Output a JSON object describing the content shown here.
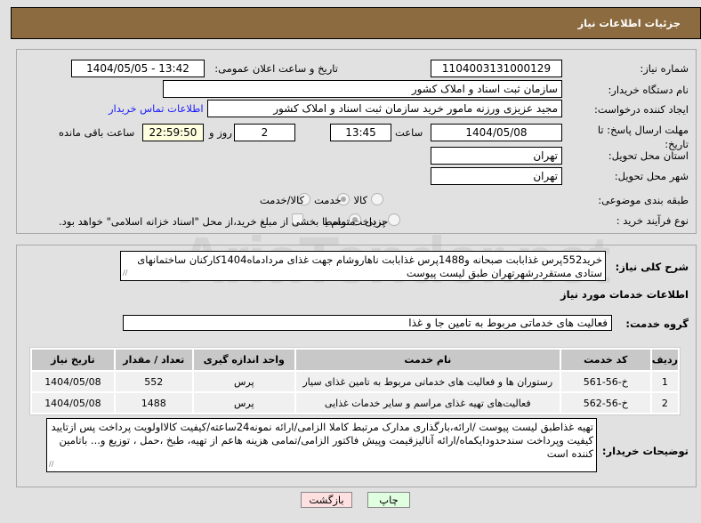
{
  "header": {
    "title": "جزئیات اطلاعات نیاز"
  },
  "form": {
    "need_number_label": "شماره نیاز:",
    "need_number": "1104003131000129",
    "announce_label": "تاریخ و ساعت اعلان عمومی:",
    "announce_value": "1404/05/05 - 13:42",
    "buyer_org_label": "نام دستگاه خریدار:",
    "buyer_org": "سازمان ثبت اسناد و املاک کشور",
    "creator_label": "ایجاد کننده درخواست:",
    "creator": "مجید عزیزی ورزنه مامور خرید سازمان ثبت اسناد و املاک کشور",
    "contact_link": "اطلاعات تماس خریدار",
    "deadline_label": "مهلت ارسال پاسخ: تا تاریخ:",
    "deadline_date": "1404/05/08",
    "time_label": "ساعت",
    "deadline_time": "13:45",
    "days": "2",
    "days_label": "روز و",
    "remaining": "22:59:50",
    "remaining_label": "ساعت باقی مانده",
    "province_label": "استان محل تحویل:",
    "province": "تهران",
    "city_label": "شهر محل تحویل:",
    "city": "تهران",
    "category_label": "طبقه بندی موضوعی:",
    "category_options": [
      "کالا",
      "خدمت",
      "کالا/خدمت"
    ],
    "category_selected": "خدمت",
    "process_label": "نوع فرآیند خرید :",
    "process_options": [
      "جزیی",
      "متوسط"
    ],
    "process_selected": "متوسط",
    "payment_note": "پرداخت تمام یا بخشی از مبلغ خرید،از محل \"اسناد خزانه اسلامی\" خواهد بود."
  },
  "details": {
    "summary_label": "شرح کلی نیاز:",
    "summary": "خرید552پرس غذابابت صبحانه و1488پرس غذابابت ناهاروشام جهت غذای مردادماه1404کارکنان ساختمانهای ستادی مستقردرشهرتهران طبق لیست پیوست",
    "services_title": "اطلاعات خدمات مورد نیاز",
    "group_label": "گروه خدمت:",
    "group": "فعالیت های خدماتی مربوط به تامین جا و غذا",
    "columns": [
      "ردیف",
      "کد خدمت",
      "نام خدمت",
      "واحد اندازه گیری",
      "تعداد / مقدار",
      "تاریخ نیاز"
    ],
    "rows": [
      [
        "1",
        "خ-56-561",
        "رستوران ها و فعالیت های خدماتی مربوط به تامین غذای سیار",
        "پرس",
        "552",
        "1404/05/08"
      ],
      [
        "2",
        "خ-56-562",
        "فعالیت‌های تهیه غذای مراسم و سایر خدمات غذایی",
        "پرس",
        "1488",
        "1404/05/08"
      ]
    ],
    "notes_label": "توضیحات خریدار:",
    "notes": "تهیه غذاطبق لیست پیوست /ارائه،بارگذاری مدارک مرتبط کاملا الزامی/ارائه نمونه24ساعته/کیفیت کالااولویت پرداخت پس ازتایید کیفیت وپرداخت سندحدودایکماه/ارائه آنالیزقیمت وپیش فاکتور الزامی/تمامی هزینه هاعم از تهیه، طبخ ،حمل ، توزیع و... باتامین کننده است"
  },
  "buttons": {
    "print": "چاپ",
    "back": "بازگشت"
  },
  "watermark": "AriaTender.net"
}
